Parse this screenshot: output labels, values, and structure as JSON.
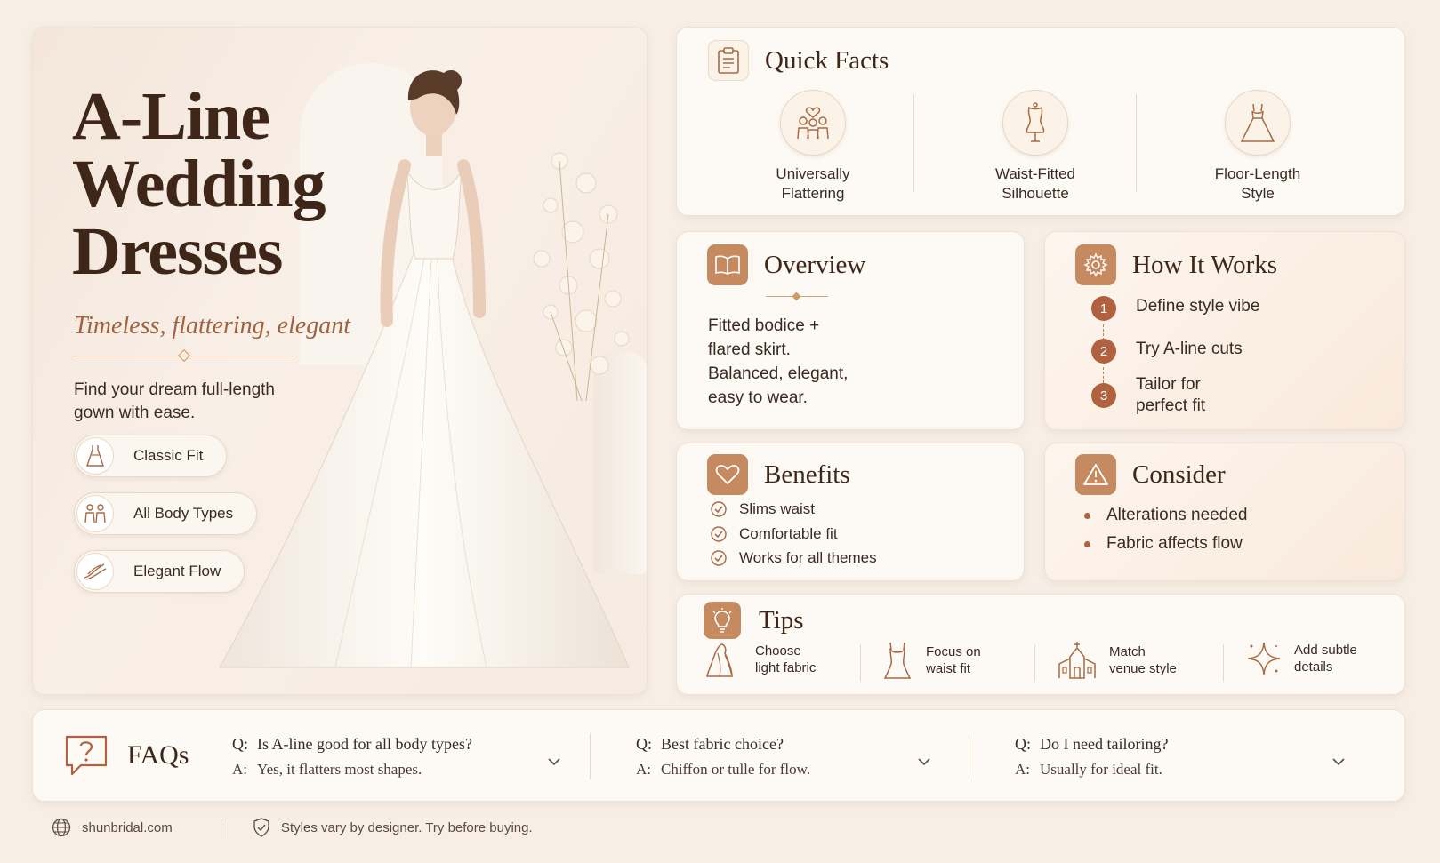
{
  "hero": {
    "title_lines": [
      "A-Line",
      "Wedding",
      "Dresses"
    ],
    "subtitle": "Timeless, flattering, elegant",
    "description": "Find your dream full-length gown with ease.",
    "features": [
      {
        "label": "Classic Fit",
        "icon": "dress-icon"
      },
      {
        "label": "All Body Types",
        "icon": "people-icon"
      },
      {
        "label": "Elegant Flow",
        "icon": "fabric-flow-icon"
      }
    ]
  },
  "quick_facts": {
    "title": "Quick Facts",
    "icon": "clipboard-icon",
    "items": [
      {
        "line1": "Universally",
        "line2": "Flattering",
        "icon": "people-heart-icon"
      },
      {
        "line1": "Waist-Fitted",
        "line2": "Silhouette",
        "icon": "dress-form-icon"
      },
      {
        "line1": "Floor-Length",
        "line2": "Style",
        "icon": "gown-icon"
      }
    ]
  },
  "overview": {
    "title": "Overview",
    "icon": "book-icon",
    "text_lines": [
      "Fitted bodice +",
      "flared skirt.",
      "Balanced, elegant,",
      "easy to wear."
    ]
  },
  "how_it_works": {
    "title": "How It Works",
    "icon": "gear-icon",
    "steps": [
      {
        "num": "1",
        "line1": "Define style vibe",
        "line2": ""
      },
      {
        "num": "2",
        "line1": "Try A-line cuts",
        "line2": ""
      },
      {
        "num": "3",
        "line1": "Tailor for",
        "line2": "perfect fit"
      }
    ]
  },
  "benefits": {
    "title": "Benefits",
    "icon": "heart-icon",
    "items": [
      "Slims waist",
      "Comfortable fit",
      "Works for all themes"
    ]
  },
  "consider": {
    "title": "Consider",
    "icon": "warning-icon",
    "items": [
      "Alterations needed",
      "Fabric affects flow"
    ]
  },
  "tips": {
    "title": "Tips",
    "icon": "lightbulb-icon",
    "items": [
      {
        "line1": "Choose",
        "line2": "light fabric",
        "icon": "veil-icon"
      },
      {
        "line1": "Focus on",
        "line2": "waist fit",
        "icon": "bodice-icon"
      },
      {
        "line1": "Match",
        "line2": "venue style",
        "icon": "chapel-icon"
      },
      {
        "line1": "Add subtle",
        "line2": "details",
        "icon": "sparkle-icon"
      }
    ]
  },
  "faq": {
    "title": "FAQs",
    "icon": "question-bubble-icon",
    "q_prefix": "Q:",
    "a_prefix": "A:",
    "items": [
      {
        "q": "Is A-line good for all body types?",
        "a": "Yes, it flatters most shapes."
      },
      {
        "q": "Best fabric choice?",
        "a": "Chiffon or tulle for flow."
      },
      {
        "q": "Do I need tailoring?",
        "a": "Usually for ideal fit."
      }
    ]
  },
  "footer": {
    "site": "shunbridal.com",
    "note": "Styles vary by designer. Try before buying."
  },
  "colors": {
    "accent": "#b06140",
    "icon_stroke": "#a86a45",
    "background": "#f7efe6"
  }
}
